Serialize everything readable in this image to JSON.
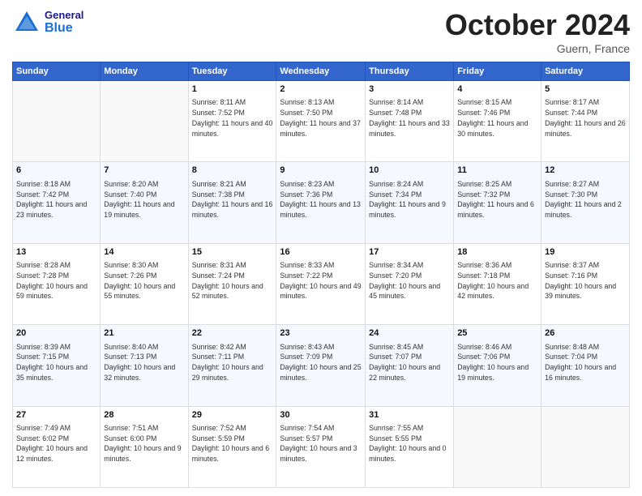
{
  "header": {
    "logo_general": "General",
    "logo_blue": "Blue",
    "month_title": "October 2024",
    "location": "Guern, France"
  },
  "days_of_week": [
    "Sunday",
    "Monday",
    "Tuesday",
    "Wednesday",
    "Thursday",
    "Friday",
    "Saturday"
  ],
  "weeks": [
    [
      {
        "day": "",
        "info": ""
      },
      {
        "day": "",
        "info": ""
      },
      {
        "day": "1",
        "info": "Sunrise: 8:11 AM\nSunset: 7:52 PM\nDaylight: 11 hours and 40 minutes."
      },
      {
        "day": "2",
        "info": "Sunrise: 8:13 AM\nSunset: 7:50 PM\nDaylight: 11 hours and 37 minutes."
      },
      {
        "day": "3",
        "info": "Sunrise: 8:14 AM\nSunset: 7:48 PM\nDaylight: 11 hours and 33 minutes."
      },
      {
        "day": "4",
        "info": "Sunrise: 8:15 AM\nSunset: 7:46 PM\nDaylight: 11 hours and 30 minutes."
      },
      {
        "day": "5",
        "info": "Sunrise: 8:17 AM\nSunset: 7:44 PM\nDaylight: 11 hours and 26 minutes."
      }
    ],
    [
      {
        "day": "6",
        "info": "Sunrise: 8:18 AM\nSunset: 7:42 PM\nDaylight: 11 hours and 23 minutes."
      },
      {
        "day": "7",
        "info": "Sunrise: 8:20 AM\nSunset: 7:40 PM\nDaylight: 11 hours and 19 minutes."
      },
      {
        "day": "8",
        "info": "Sunrise: 8:21 AM\nSunset: 7:38 PM\nDaylight: 11 hours and 16 minutes."
      },
      {
        "day": "9",
        "info": "Sunrise: 8:23 AM\nSunset: 7:36 PM\nDaylight: 11 hours and 13 minutes."
      },
      {
        "day": "10",
        "info": "Sunrise: 8:24 AM\nSunset: 7:34 PM\nDaylight: 11 hours and 9 minutes."
      },
      {
        "day": "11",
        "info": "Sunrise: 8:25 AM\nSunset: 7:32 PM\nDaylight: 11 hours and 6 minutes."
      },
      {
        "day": "12",
        "info": "Sunrise: 8:27 AM\nSunset: 7:30 PM\nDaylight: 11 hours and 2 minutes."
      }
    ],
    [
      {
        "day": "13",
        "info": "Sunrise: 8:28 AM\nSunset: 7:28 PM\nDaylight: 10 hours and 59 minutes."
      },
      {
        "day": "14",
        "info": "Sunrise: 8:30 AM\nSunset: 7:26 PM\nDaylight: 10 hours and 55 minutes."
      },
      {
        "day": "15",
        "info": "Sunrise: 8:31 AM\nSunset: 7:24 PM\nDaylight: 10 hours and 52 minutes."
      },
      {
        "day": "16",
        "info": "Sunrise: 8:33 AM\nSunset: 7:22 PM\nDaylight: 10 hours and 49 minutes."
      },
      {
        "day": "17",
        "info": "Sunrise: 8:34 AM\nSunset: 7:20 PM\nDaylight: 10 hours and 45 minutes."
      },
      {
        "day": "18",
        "info": "Sunrise: 8:36 AM\nSunset: 7:18 PM\nDaylight: 10 hours and 42 minutes."
      },
      {
        "day": "19",
        "info": "Sunrise: 8:37 AM\nSunset: 7:16 PM\nDaylight: 10 hours and 39 minutes."
      }
    ],
    [
      {
        "day": "20",
        "info": "Sunrise: 8:39 AM\nSunset: 7:15 PM\nDaylight: 10 hours and 35 minutes."
      },
      {
        "day": "21",
        "info": "Sunrise: 8:40 AM\nSunset: 7:13 PM\nDaylight: 10 hours and 32 minutes."
      },
      {
        "day": "22",
        "info": "Sunrise: 8:42 AM\nSunset: 7:11 PM\nDaylight: 10 hours and 29 minutes."
      },
      {
        "day": "23",
        "info": "Sunrise: 8:43 AM\nSunset: 7:09 PM\nDaylight: 10 hours and 25 minutes."
      },
      {
        "day": "24",
        "info": "Sunrise: 8:45 AM\nSunset: 7:07 PM\nDaylight: 10 hours and 22 minutes."
      },
      {
        "day": "25",
        "info": "Sunrise: 8:46 AM\nSunset: 7:06 PM\nDaylight: 10 hours and 19 minutes."
      },
      {
        "day": "26",
        "info": "Sunrise: 8:48 AM\nSunset: 7:04 PM\nDaylight: 10 hours and 16 minutes."
      }
    ],
    [
      {
        "day": "27",
        "info": "Sunrise: 7:49 AM\nSunset: 6:02 PM\nDaylight: 10 hours and 12 minutes."
      },
      {
        "day": "28",
        "info": "Sunrise: 7:51 AM\nSunset: 6:00 PM\nDaylight: 10 hours and 9 minutes."
      },
      {
        "day": "29",
        "info": "Sunrise: 7:52 AM\nSunset: 5:59 PM\nDaylight: 10 hours and 6 minutes."
      },
      {
        "day": "30",
        "info": "Sunrise: 7:54 AM\nSunset: 5:57 PM\nDaylight: 10 hours and 3 minutes."
      },
      {
        "day": "31",
        "info": "Sunrise: 7:55 AM\nSunset: 5:55 PM\nDaylight: 10 hours and 0 minutes."
      },
      {
        "day": "",
        "info": ""
      },
      {
        "day": "",
        "info": ""
      }
    ]
  ]
}
